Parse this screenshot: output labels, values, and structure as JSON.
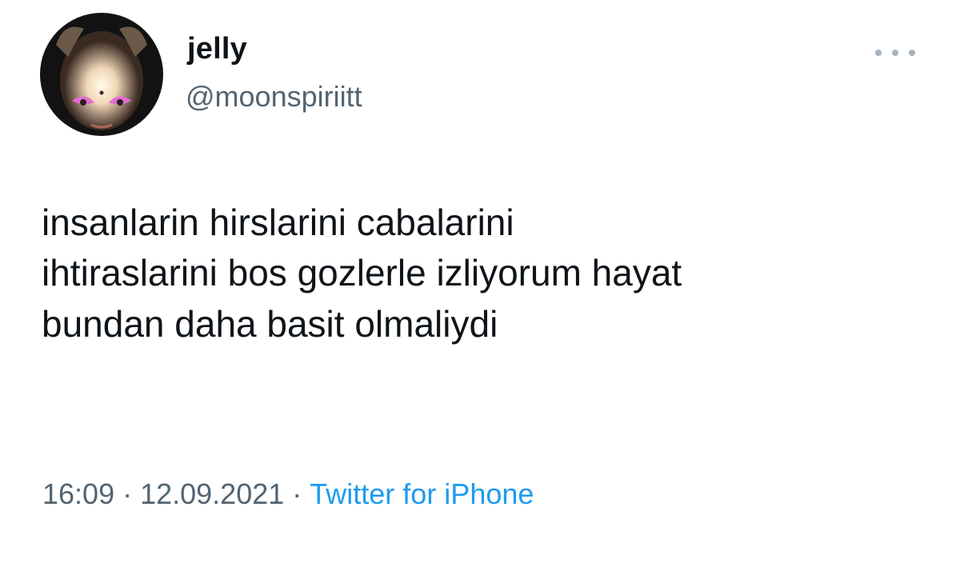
{
  "tweet": {
    "author": {
      "name": "jelly",
      "handle": "@moonspiriitt"
    },
    "text_lines": [
      "insanlarin hirslarini cabalarini",
      "ihtiraslarini bos gozlerle izliyorum hayat",
      "bundan daha basit olmaliydi"
    ],
    "time": "16:09",
    "date": "12.09.2021",
    "separator": "·",
    "source": "Twitter for iPhone",
    "more_icon": "more-horizontal-icon"
  },
  "colors": {
    "text": "#0f1419",
    "secondary": "#536471",
    "link": "#1d9bf0",
    "background": "#ffffff"
  }
}
